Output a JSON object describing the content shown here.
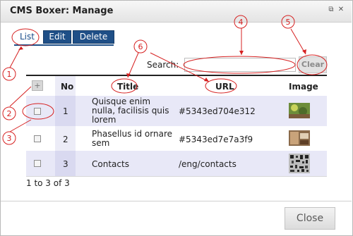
{
  "window": {
    "title": "CMS Boxer: Manage"
  },
  "tabs": [
    {
      "label": "List"
    },
    {
      "label": "Edit"
    },
    {
      "label": "Delete"
    }
  ],
  "search": {
    "label": "Search:",
    "value": "",
    "clear_label": "Clear"
  },
  "table": {
    "columns": [
      "No",
      "Title",
      "URL",
      "Image"
    ],
    "rows": [
      {
        "no": "1",
        "title": "Quisque enim nulla, facilisis quis lorem",
        "url": "#5343ed704e312"
      },
      {
        "no": "2",
        "title": "Phasellus id ornare sem",
        "url": "#5343ed7e7a3f9"
      },
      {
        "no": "3",
        "title": "Contacts",
        "url": "/eng/contacts"
      }
    ]
  },
  "pager": {
    "text": "1 to 3 of 3"
  },
  "footer": {
    "close_label": "Close"
  },
  "annotations": [
    "1",
    "2",
    "3",
    "4",
    "5",
    "6"
  ],
  "colors": {
    "accent": "#1f4f87",
    "callout": "#d62020"
  },
  "icons": {
    "add": "plus-icon",
    "popout": "popout-icon",
    "close": "close-icon"
  }
}
